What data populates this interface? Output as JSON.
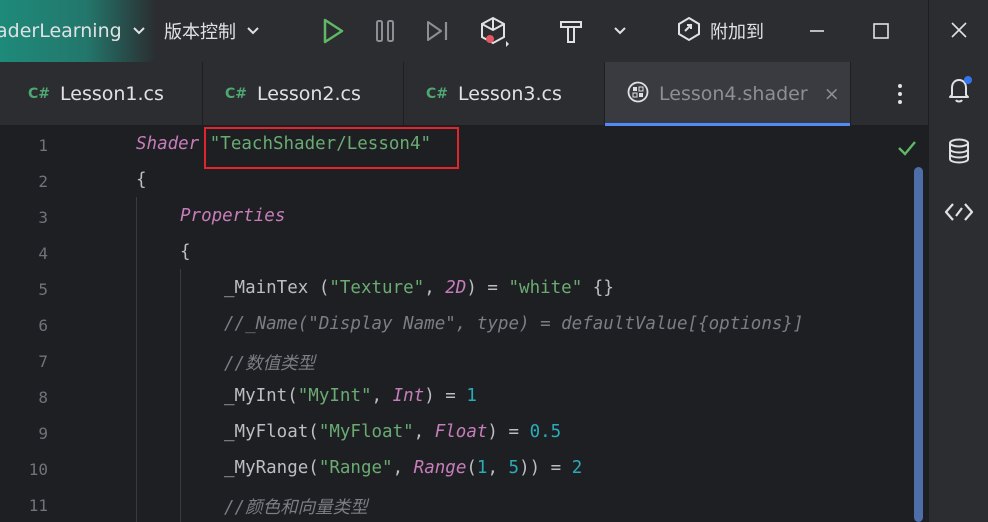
{
  "toolbar": {
    "project_name": "aderLearning",
    "vcs_label": "版本控制",
    "attach_label": "附加到"
  },
  "icons": {
    "run": "run-triangle-icon",
    "pause": "pause-icon",
    "step": "step-icon",
    "debug_unity": "unity-debug-icon",
    "build": "hammer-icon",
    "attach": "attach-process-icon",
    "minimize": "minimize-icon",
    "maximize": "maximize-icon",
    "close": "close-icon",
    "notifications": "bell-icon",
    "database": "database-icon",
    "endpoints": "endpoints-icon"
  },
  "colors": {
    "accent_teal": "#1e8a7a",
    "run_green": "#5fb865",
    "tab_underline": "#548af7",
    "highlight_red": "#e0262c",
    "notification_dot": "#3574f0"
  },
  "tabs": [
    {
      "prefix": "C#",
      "label": "Lesson1.cs",
      "active": false
    },
    {
      "prefix": "C#",
      "label": "Lesson2.cs",
      "active": false
    },
    {
      "prefix": "C#",
      "label": "Lesson3.cs",
      "active": false
    },
    {
      "prefix": "",
      "label": "Lesson4.shader",
      "active": true,
      "close": "×"
    }
  ],
  "editor": {
    "line_numbers": [
      "1",
      "2",
      "3",
      "4",
      "5",
      "6",
      "7",
      "8",
      "9",
      "10",
      "11"
    ],
    "lines": {
      "l1": {
        "kw": "Shader",
        "str": "\"TeachShader/Lesson4\""
      },
      "l2": {
        "text": "{"
      },
      "l3": {
        "kw": "Properties"
      },
      "l4": {
        "text": "{"
      },
      "l5": {
        "a": "_MainTex (",
        "s1": "\"Texture\"",
        "b": ", ",
        "t": "2D",
        "c": ") = ",
        "s2": "\"white\"",
        "d": " {}"
      },
      "l6": {
        "cmt": "//_Name(\"Display Name\", type) = defaultValue[{options}]"
      },
      "l7": {
        "cmt": "//数值类型"
      },
      "l8": {
        "a": "_MyInt(",
        "s": "\"MyInt\"",
        "b": ", ",
        "t": "Int",
        "c": ") = ",
        "n": "1"
      },
      "l9": {
        "a": "_MyFloat(",
        "s": "\"MyFloat\"",
        "b": ", ",
        "t": "Float",
        "c": ") = ",
        "n": "0.5"
      },
      "l10": {
        "a": "_MyRange(",
        "s": "\"Range\"",
        "b": ", ",
        "t": "Range",
        "c": "(",
        "n1": "1",
        "d": ", ",
        "n2": "5",
        "e": ")) = ",
        "n3": "2"
      },
      "l11": {
        "cmt": "//颜色和向量类型"
      }
    }
  }
}
